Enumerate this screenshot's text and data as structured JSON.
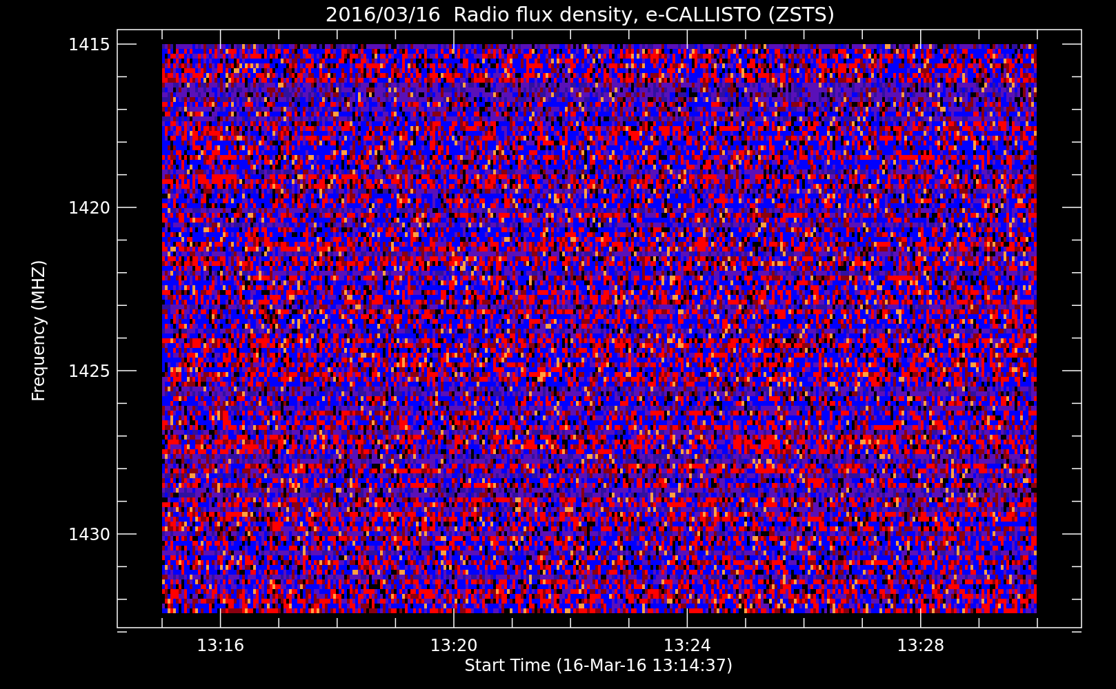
{
  "title": "2016/03/16  Radio flux density, e-CALLISTO (ZSTS)",
  "y_axis": {
    "label": "Frequency (MHZ)",
    "tick_labels": [
      "1415",
      "1420",
      "1425",
      "1430"
    ]
  },
  "x_axis": {
    "label": "Start Time (16-Mar-16 13:14:37)",
    "tick_labels": [
      "13:16",
      "13:20",
      "13:24",
      "13:28"
    ]
  }
}
